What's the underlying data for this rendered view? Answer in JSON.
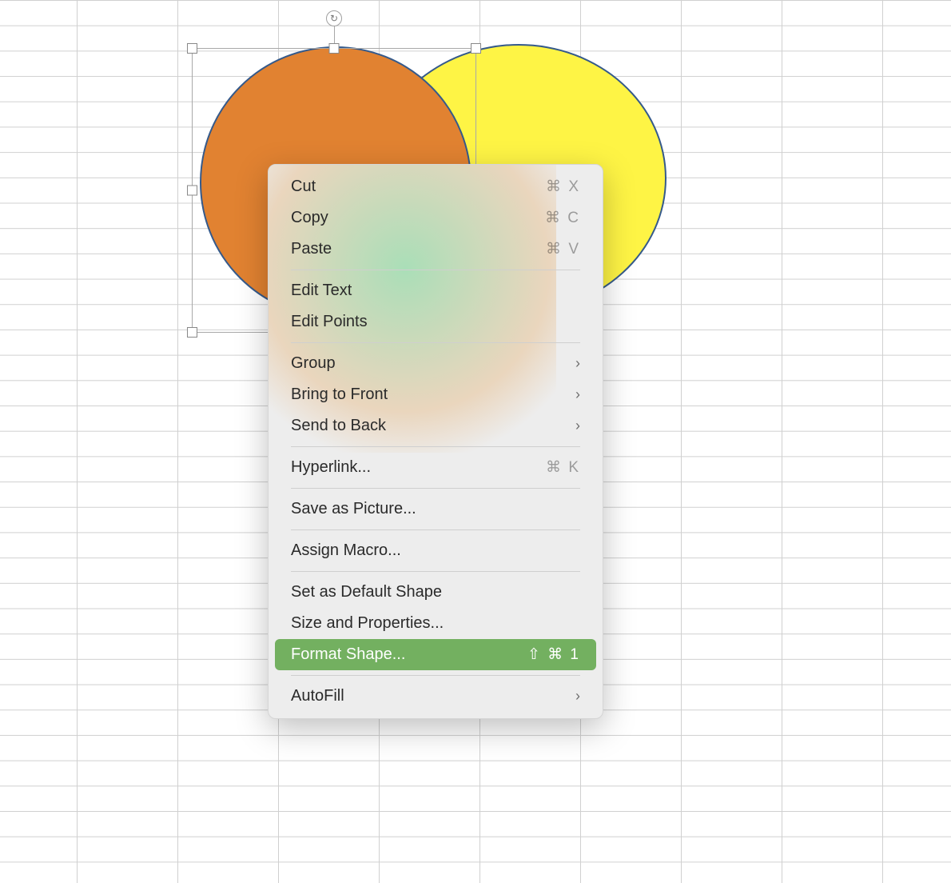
{
  "shapes": {
    "back": {
      "name": "yellow-oval",
      "fill": "#fef445",
      "stroke": "#355a8b"
    },
    "front_selected": {
      "name": "orange-oval",
      "fill": "#e18231",
      "stroke": "#355a8b"
    }
  },
  "selection": {
    "rotation_icon": "↻"
  },
  "menu": {
    "items": [
      {
        "label": "Cut",
        "shortcut": "⌘ X",
        "submenu": false,
        "highlight": false
      },
      {
        "label": "Copy",
        "shortcut": "⌘ C",
        "submenu": false,
        "highlight": false
      },
      {
        "label": "Paste",
        "shortcut": "⌘ V",
        "submenu": false,
        "highlight": false
      },
      {
        "sep": true
      },
      {
        "label": "Edit Text",
        "shortcut": "",
        "submenu": false,
        "highlight": false
      },
      {
        "label": "Edit Points",
        "shortcut": "",
        "submenu": false,
        "highlight": false
      },
      {
        "sep": true
      },
      {
        "label": "Group",
        "shortcut": "",
        "submenu": true,
        "highlight": false
      },
      {
        "label": "Bring to Front",
        "shortcut": "",
        "submenu": true,
        "highlight": false
      },
      {
        "label": "Send to Back",
        "shortcut": "",
        "submenu": true,
        "highlight": false
      },
      {
        "sep": true
      },
      {
        "label": "Hyperlink...",
        "shortcut": "⌘ K",
        "submenu": false,
        "highlight": false
      },
      {
        "sep": true
      },
      {
        "label": "Save as Picture...",
        "shortcut": "",
        "submenu": false,
        "highlight": false
      },
      {
        "sep": true
      },
      {
        "label": "Assign Macro...",
        "shortcut": "",
        "submenu": false,
        "highlight": false
      },
      {
        "sep": true
      },
      {
        "label": "Set as Default Shape",
        "shortcut": "",
        "submenu": false,
        "highlight": false
      },
      {
        "label": "Size and Properties...",
        "shortcut": "",
        "submenu": false,
        "highlight": false
      },
      {
        "label": "Format Shape...",
        "shortcut": "⇧ ⌘ 1",
        "submenu": false,
        "highlight": true
      },
      {
        "sep": true
      },
      {
        "label": "AutoFill",
        "shortcut": "",
        "submenu": true,
        "highlight": false
      }
    ]
  }
}
